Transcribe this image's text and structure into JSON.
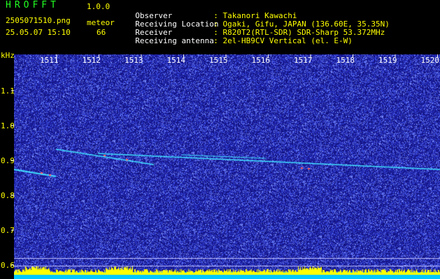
{
  "app": {
    "title": "HROFFT",
    "version": "1.0.0",
    "filename": "2505071510.png",
    "datetime": "25.05.07 15:10",
    "meteor_label": "meteor",
    "meteor_count": "66"
  },
  "info": [
    {
      "label": "Observer",
      "value": ": Takanori Kawachi"
    },
    {
      "label": "Receiving Location",
      "value": ": Ogaki, Gifu, JAPAN (136.60E, 35.35N)"
    },
    {
      "label": "Receiver",
      "value": ": R820T2(RTL-SDR) SDR-Sharp 53.372MHz"
    },
    {
      "label": "Receiving antenna",
      "value": ": 2el-HB9CV Vertical (el. E-W)"
    }
  ],
  "axis": {
    "unit": "kHz",
    "ticks": [
      "1.1",
      "1.0",
      "0.9",
      "0.8",
      "0.7",
      "0.6"
    ],
    "tick_values": [
      1.1,
      1.0,
      0.9,
      0.8,
      0.7,
      0.6
    ],
    "minutes": [
      "1511",
      "1512",
      "1513",
      "1514",
      "1515",
      "1516",
      "1517",
      "1518",
      "1519",
      "1520"
    ]
  },
  "colors": {
    "background": "#1a1aa0",
    "noise": "#6a7cff",
    "echo": "#40e0ff",
    "label_yellow": "#ffff00",
    "title_green": "#22ff22",
    "bottom_bar": "#00c8ff",
    "bottom_peak": "#ffff00"
  }
}
